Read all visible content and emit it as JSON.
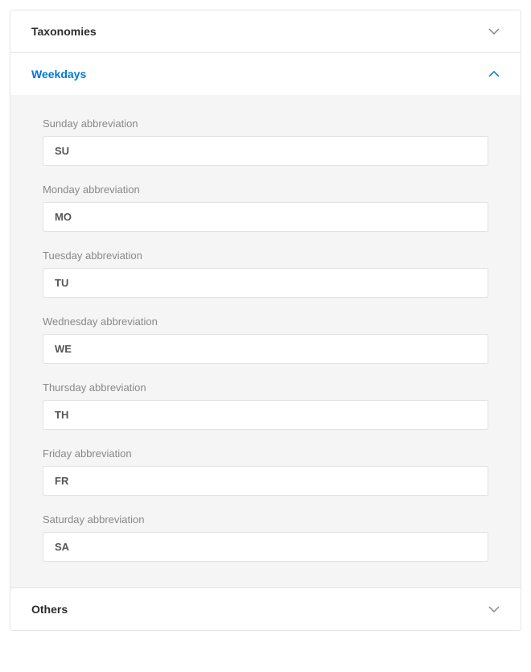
{
  "sections": {
    "taxonomies": {
      "title": "Taxonomies",
      "expanded": false
    },
    "weekdays": {
      "title": "Weekdays",
      "expanded": true,
      "fields": {
        "sunday": {
          "label": "Sunday abbreviation",
          "value": "SU"
        },
        "monday": {
          "label": "Monday abbreviation",
          "value": "MO"
        },
        "tuesday": {
          "label": "Tuesday abbreviation",
          "value": "TU"
        },
        "wednesday": {
          "label": "Wednesday abbreviation",
          "value": "WE"
        },
        "thursday": {
          "label": "Thursday abbreviation",
          "value": "TH"
        },
        "friday": {
          "label": "Friday abbreviation",
          "value": "FR"
        },
        "saturday": {
          "label": "Saturday abbreviation",
          "value": "SA"
        }
      }
    },
    "others": {
      "title": "Others",
      "expanded": false
    }
  }
}
